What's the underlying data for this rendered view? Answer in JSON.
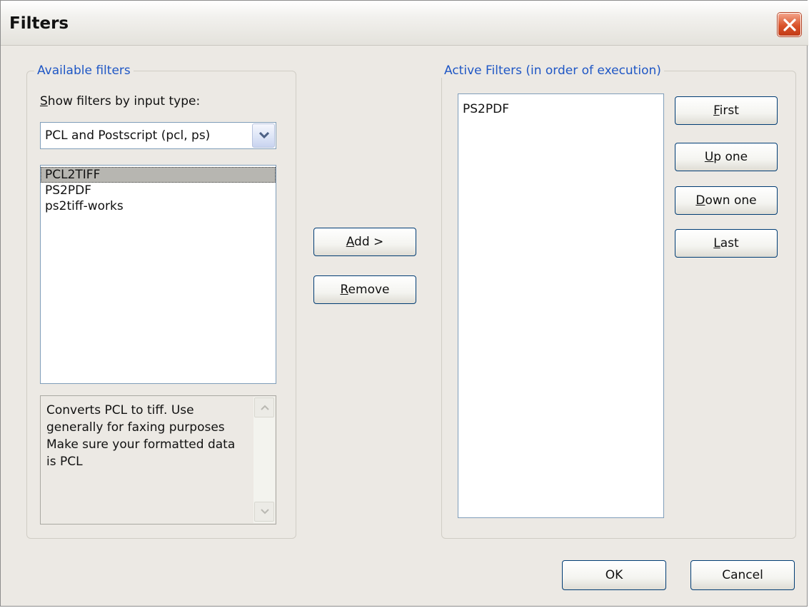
{
  "window": {
    "title": "Filters"
  },
  "available": {
    "legend": "Available filters",
    "show_by_label": "Show filters by input type:",
    "input_type_selected": "PCL and Postscript (pcl, ps)",
    "items": [
      "PCL2TIFF",
      "PS2PDF",
      "ps2tiff-works"
    ],
    "selected_item": "PCL2TIFF",
    "description": "Converts PCL to tiff. Use generally for faxing purposes\nMake sure your formatted data is PCL"
  },
  "middle": {
    "add_label": "Add >",
    "remove_label": "Remove"
  },
  "active": {
    "legend": "Active Filters (in order of execution)",
    "items": [
      "PS2PDF"
    ],
    "first_label": "First",
    "up_label": "Up one",
    "down_label": "Down one",
    "last_label": "Last"
  },
  "footer": {
    "ok_label": "OK",
    "cancel_label": "Cancel"
  },
  "colors": {
    "group_legend": "#1f57c5",
    "close_button": "#d9532b"
  },
  "icons": {
    "close": "close-icon",
    "dropdown": "chevron-down-icon",
    "scroll_up": "scroll-up-arrow-icon",
    "scroll_down": "scroll-down-arrow-icon"
  }
}
